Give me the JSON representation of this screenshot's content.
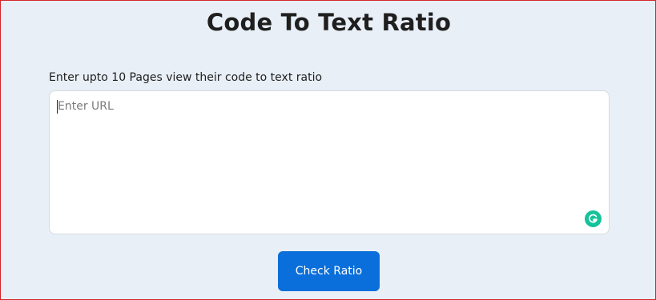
{
  "page": {
    "title": "Code To Text Ratio"
  },
  "form": {
    "label": "Enter upto 10 Pages view their code to text ratio",
    "url_input": {
      "placeholder": "Enter URL",
      "value": ""
    },
    "submit_label": "Check Ratio"
  },
  "icons": {
    "grammarly": "grammarly-icon"
  },
  "colors": {
    "page_bg": "#e9eff7",
    "frame_border": "#d4262b",
    "button_bg": "#0a6fdb",
    "grammarly": "#15c39a"
  }
}
